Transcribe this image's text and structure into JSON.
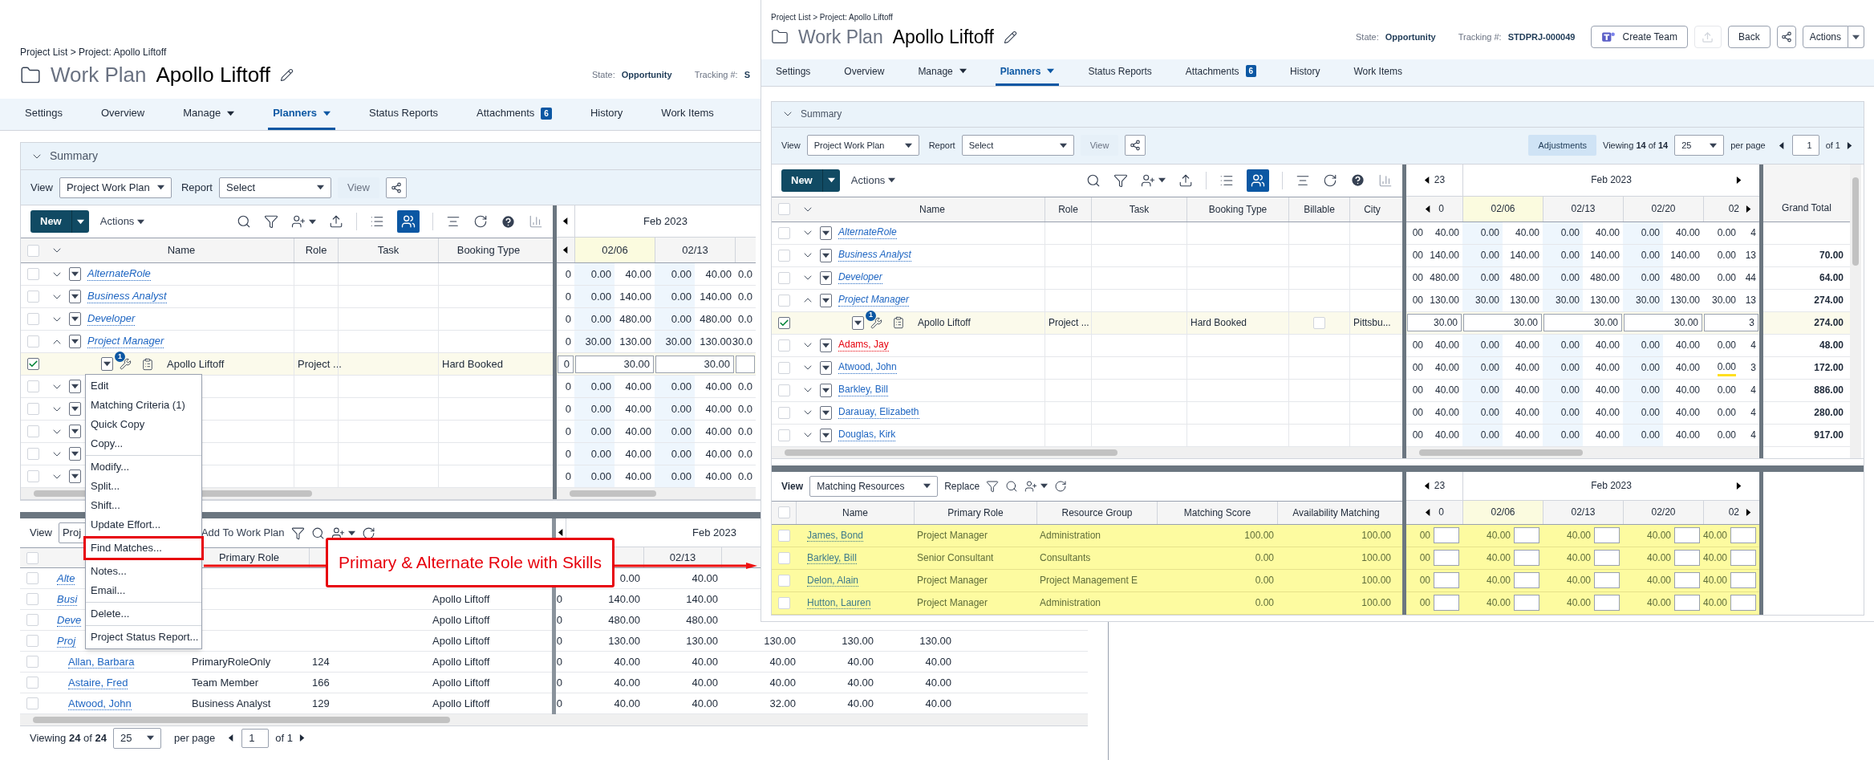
{
  "left": {
    "breadcrumb": "Project List > Project: Apollo Liftoff",
    "title_prefix": "Work Plan",
    "title": "Apollo Liftoff",
    "state_label": "State:",
    "state": "Opportunity",
    "tracking_label": "Tracking #:",
    "tracking": "S",
    "tabs": [
      {
        "label": "Settings",
        "selected": false,
        "dropdown": false
      },
      {
        "label": "Overview",
        "selected": false,
        "dropdown": false
      },
      {
        "label": "Manage",
        "selected": false,
        "dropdown": true
      },
      {
        "label": "Planners",
        "selected": true,
        "dropdown": true
      },
      {
        "label": "Status Reports",
        "selected": false,
        "dropdown": false
      },
      {
        "label": "Attachments",
        "selected": false,
        "dropdown": false,
        "badge": "6"
      },
      {
        "label": "History",
        "selected": false,
        "dropdown": false
      },
      {
        "label": "Work Items",
        "selected": false,
        "dropdown": false
      }
    ],
    "summary": {
      "label": "Summary",
      "expanded": true
    },
    "view_bar": {
      "view_label": "View",
      "view": "Project Work Plan",
      "report_label": "Report",
      "report": "Select",
      "view_button": "View"
    },
    "grid": {
      "new": "New",
      "actions": "Actions",
      "all_checked": false,
      "columns": [
        "Name",
        "Role",
        "Task",
        "Booking Type"
      ],
      "timeline": {
        "month": "Feb 2023",
        "dates": [
          {
            "label": "02/06",
            "selected": true
          },
          {
            "label": "02/13",
            "selected": false
          }
        ]
      },
      "rows": [
        {
          "kind": "group",
          "name": "AlternateRole",
          "checked": false,
          "expanded": false,
          "cells": [
            [
              "0"
            ],
            [
              "0.00",
              "40.00"
            ],
            [
              "0.00",
              "40.00"
            ],
            [
              "0.0"
            ]
          ]
        },
        {
          "kind": "group",
          "name": "Business Analyst",
          "checked": false,
          "expanded": false,
          "cells": [
            [
              "0"
            ],
            [
              "0.00",
              "140.00"
            ],
            [
              "0.00",
              "140.00"
            ],
            [
              "0.0"
            ]
          ]
        },
        {
          "kind": "group",
          "name": "Developer",
          "checked": false,
          "expanded": false,
          "cells": [
            [
              "0"
            ],
            [
              "0.00",
              "480.00"
            ],
            [
              "0.00",
              "480.00"
            ],
            [
              "0.0"
            ]
          ]
        },
        {
          "kind": "group",
          "name": "Project Manager",
          "checked": false,
          "expanded": true,
          "cells": [
            [
              "0"
            ],
            [
              "30.00",
              "130.00"
            ],
            [
              "30.00",
              "130.00"
            ],
            [
              "30.0"
            ]
          ]
        },
        {
          "kind": "task",
          "name": "Apollo Liftoff",
          "badge": "1",
          "role": "Project ...",
          "booking": "Hard Booked",
          "checked": true,
          "cells": [
            "0",
            "30.00",
            "30.00"
          ]
        },
        {
          "kind": "resource",
          "checked": false,
          "expanded": false,
          "cells": [
            [
              "0"
            ],
            [
              "0.00",
              "40.00"
            ],
            [
              "0.00",
              "40.00"
            ],
            [
              "0.0"
            ]
          ]
        },
        {
          "kind": "resource",
          "checked": false,
          "expanded": false,
          "cells": [
            [
              "0"
            ],
            [
              "0.00",
              "40.00"
            ],
            [
              "0.00",
              "40.00"
            ],
            [
              "0.0"
            ]
          ]
        },
        {
          "kind": "resource",
          "checked": false,
          "expanded": false,
          "cells": [
            [
              "0"
            ],
            [
              "0.00",
              "40.00"
            ],
            [
              "0.00",
              "40.00"
            ],
            [
              "0.0"
            ]
          ]
        },
        {
          "kind": "resource",
          "checked": false,
          "expanded": false,
          "cells": [
            [
              "0"
            ],
            [
              "0.00",
              "40.00"
            ],
            [
              "0.00",
              "40.00"
            ],
            [
              "0.0"
            ]
          ]
        },
        {
          "kind": "resource",
          "checked": false,
          "expanded": false,
          "cells": [
            [
              "0"
            ],
            [
              "0.00",
              "40.00"
            ],
            [
              "0.00",
              "40.00"
            ],
            [
              "0.0"
            ]
          ]
        }
      ]
    },
    "menu": [
      {
        "label": "Edit",
        "divider_above": false,
        "highlighted": false
      },
      {
        "label": "Matching Criteria (1)",
        "divider_above": false,
        "highlighted": false
      },
      {
        "label": "Quick Copy",
        "divider_above": false,
        "highlighted": false
      },
      {
        "label": "Copy...",
        "divider_above": false,
        "highlighted": false
      },
      {
        "label": "Modify...",
        "divider_above": true,
        "highlighted": false
      },
      {
        "label": "Split...",
        "divider_above": false,
        "highlighted": false
      },
      {
        "label": "Shift...",
        "divider_above": false,
        "highlighted": false
      },
      {
        "label": "Update Effort...",
        "divider_above": false,
        "highlighted": false
      },
      {
        "label": "Find Matches...",
        "divider_above": true,
        "highlighted": true
      },
      {
        "label": "Notes...",
        "divider_above": true,
        "highlighted": false
      },
      {
        "label": "Email...",
        "divider_above": false,
        "highlighted": false
      },
      {
        "label": "Delete...",
        "divider_above": true,
        "highlighted": false
      },
      {
        "label": "Project Status Report...",
        "divider_above": true,
        "highlighted": false
      }
    ],
    "lower": {
      "view_label": "View",
      "view": "Proj",
      "add": "Add To Work Plan",
      "all_checked": false,
      "role_header": "Primary Role",
      "timeline": {
        "month": "Feb 2023",
        "dates": [
          {
            "label": "02/13",
            "selected": false
          }
        ]
      },
      "rows": [
        {
          "name": "Alte",
          "kind": "group",
          "checked": false,
          "cells": [
            "",
            "0.00",
            "40.00"
          ]
        },
        {
          "name": "Busi",
          "kind": "group",
          "checked": false,
          "project": "Apollo Liftoff",
          "cells": [
            "0",
            "140.00",
            "140.00"
          ]
        },
        {
          "name": "Deve",
          "kind": "group",
          "checked": false,
          "project": "Apollo Liftoff",
          "cells": [
            "0",
            "480.00",
            "480.00"
          ]
        },
        {
          "name": "Proj",
          "kind": "group",
          "checked": false,
          "project": "Apollo Liftoff",
          "cells": [
            "0",
            "130.00",
            "130.00",
            "130.00",
            "130.00",
            "130.00"
          ]
        },
        {
          "name": "Allan, Barbara",
          "kind": "resource",
          "checked": false,
          "role": "PrimaryRoleOnly",
          "number": "124",
          "project": "Apollo Liftoff",
          "cells": [
            "0",
            "40.00",
            "40.00",
            "40.00",
            "40.00",
            "40.00"
          ]
        },
        {
          "name": "Astaire, Fred",
          "kind": "resource",
          "checked": false,
          "role": "Team Member",
          "number": "166",
          "project": "Apollo Liftoff",
          "cells": [
            "0",
            "40.00",
            "40.00",
            "40.00",
            "40.00",
            "40.00"
          ]
        },
        {
          "name": "Atwood, John",
          "kind": "resource",
          "checked": false,
          "role": "Business Analyst",
          "number": "129",
          "project": "Apollo Liftoff",
          "cells": [
            "0",
            "40.00",
            "40.00",
            "32.00",
            "40.00",
            "40.00"
          ]
        }
      ],
      "footer": {
        "viewing": "Viewing **24** of **24**",
        "per_page_value": "25",
        "per_page": "per page",
        "page": "1",
        "of": "of 1"
      }
    }
  },
  "right": {
    "breadcrumb": "Project List > Project: Apollo Liftoff",
    "title_prefix": "Work Plan",
    "title": "Apollo Liftoff",
    "state_label": "State:",
    "state": "Opportunity",
    "tracking_label": "Tracking #:",
    "tracking": "STDPRJ-000049",
    "create_team": "Create Team",
    "back": "Back",
    "actions": "Actions",
    "tabs": [
      {
        "label": "Settings",
        "selected": false,
        "dropdown": false
      },
      {
        "label": "Overview",
        "selected": false,
        "dropdown": false
      },
      {
        "label": "Manage",
        "selected": false,
        "dropdown": true
      },
      {
        "label": "Planners",
        "selected": true,
        "dropdown": true
      },
      {
        "label": "Status Reports",
        "selected": false,
        "dropdown": false
      },
      {
        "label": "Attachments",
        "selected": false,
        "dropdown": false,
        "badge": "6"
      },
      {
        "label": "History",
        "selected": false,
        "dropdown": false
      },
      {
        "label": "Work Items",
        "selected": false,
        "dropdown": false
      }
    ],
    "summary": {
      "label": "Summary",
      "expanded": true
    },
    "view_bar": {
      "view_label": "View",
      "view": "Project Work Plan",
      "report_label": "Report",
      "report": "Select",
      "view_button": "View",
      "adjustments": "Adjustments",
      "viewing": "Viewing **14** of **14**",
      "per_page_value": "25",
      "per_page": "per page",
      "page": "1",
      "of": "of 1"
    },
    "grid": {
      "new": "New",
      "actions": "Actions",
      "all_checked": false,
      "columns": [
        "Name",
        "Role",
        "Task",
        "Booking Type",
        "Billable",
        "City"
      ],
      "total_header": "Grand Total",
      "timeline": {
        "month": "Feb 2023",
        "month_prev": "23",
        "lead_label": "0",
        "tail_label": "02",
        "dates": [
          {
            "label": "02/06",
            "selected": true
          },
          {
            "label": "02/13",
            "selected": false
          },
          {
            "label": "02/20",
            "selected": false
          }
        ]
      },
      "rows": [
        {
          "kind": "group",
          "name": "AlternateRole",
          "checked": false,
          "expanded": false,
          "highlighted": false,
          "cells": [
            [
              "00",
              "40.00"
            ],
            [
              "0.00",
              "40.00"
            ],
            [
              "0.00",
              "40.00"
            ],
            [
              "0.00",
              "40.00"
            ],
            [
              "0.00",
              "4"
            ]
          ]
        },
        {
          "kind": "group",
          "name": "Business Analyst",
          "checked": false,
          "expanded": false,
          "highlighted": false,
          "total": "70.00",
          "cells": [
            [
              "00",
              "140.00"
            ],
            [
              "0.00",
              "140.00"
            ],
            [
              "0.00",
              "140.00"
            ],
            [
              "0.00",
              "140.00"
            ],
            [
              "0.00",
              "13"
            ]
          ]
        },
        {
          "kind": "group",
          "name": "Developer",
          "checked": false,
          "expanded": false,
          "highlighted": false,
          "total": "64.00",
          "cells": [
            [
              "00",
              "480.00"
            ],
            [
              "0.00",
              "480.00"
            ],
            [
              "0.00",
              "480.00"
            ],
            [
              "0.00",
              "480.00"
            ],
            [
              "0.00",
              "44"
            ]
          ]
        },
        {
          "kind": "group",
          "name": "Project Manager",
          "checked": false,
          "expanded": true,
          "highlighted": false,
          "total": "274.00",
          "cells": [
            [
              "00",
              "130.00"
            ],
            [
              "30.00",
              "130.00"
            ],
            [
              "30.00",
              "130.00"
            ],
            [
              "30.00",
              "130.00"
            ],
            [
              "30.00",
              "13"
            ]
          ]
        },
        {
          "kind": "task",
          "name": "Apollo Liftoff",
          "badge": "1",
          "role": "Project ...",
          "booking": "Hard Booked",
          "billable": false,
          "city": "Pittsbu...",
          "checked": true,
          "highlighted": false,
          "total": "274.00",
          "cells": [
            "30.00",
            "30.00",
            "30.00",
            "30.00",
            "3"
          ]
        },
        {
          "kind": "resource",
          "name": "Adams, Jay",
          "overallocated": true,
          "checked": false,
          "expanded": false,
          "highlighted": false,
          "total": "48.00",
          "cells": [
            [
              "00",
              "40.00"
            ],
            [
              "0.00",
              "40.00"
            ],
            [
              "0.00",
              "40.00"
            ],
            [
              "0.00",
              "40.00"
            ],
            [
              "0.00",
              "4"
            ]
          ]
        },
        {
          "kind": "resource",
          "name": "Atwood, John",
          "overallocated": false,
          "checked": false,
          "expanded": false,
          "highlighted": true,
          "total": "172.00",
          "cells": [
            [
              "00",
              "40.00"
            ],
            [
              "0.00",
              "40.00"
            ],
            [
              "0.00",
              "40.00"
            ],
            [
              "0.00",
              "40.00"
            ],
            [
              "0.00",
              "3"
            ]
          ]
        },
        {
          "kind": "resource",
          "name": "Barkley, Bill",
          "overallocated": false,
          "checked": false,
          "expanded": false,
          "highlighted": false,
          "total": "886.00",
          "cells": [
            [
              "00",
              "40.00"
            ],
            [
              "0.00",
              "40.00"
            ],
            [
              "0.00",
              "40.00"
            ],
            [
              "0.00",
              "40.00"
            ],
            [
              "0.00",
              "4"
            ]
          ]
        },
        {
          "kind": "resource",
          "name": "Darauay, Elizabeth",
          "overallocated": false,
          "checked": false,
          "expanded": false,
          "highlighted": false,
          "total": "280.00",
          "cells": [
            [
              "00",
              "40.00"
            ],
            [
              "0.00",
              "40.00"
            ],
            [
              "0.00",
              "40.00"
            ],
            [
              "0.00",
              "40.00"
            ],
            [
              "0.00",
              "4"
            ]
          ]
        },
        {
          "kind": "resource",
          "name": "Douglas, Kirk",
          "overallocated": false,
          "checked": false,
          "expanded": false,
          "highlighted": false,
          "total": "917.00",
          "cells": [
            [
              "00",
              "40.00"
            ],
            [
              "0.00",
              "40.00"
            ],
            [
              "0.00",
              "40.00"
            ],
            [
              "0.00",
              "40.00"
            ],
            [
              "0.00",
              "4"
            ]
          ]
        }
      ]
    },
    "lower": {
      "view_label": "View",
      "view": "Matching Resources",
      "replace": "Replace",
      "all_checked": false,
      "columns": [
        "Name",
        "Primary Role",
        "Resource Group",
        "Matching Score",
        "Availability Matching"
      ],
      "timeline": {
        "month": "Feb 2023",
        "month_prev": "23",
        "lead_label": "0",
        "tail_label": "02",
        "dates": [
          {
            "label": "02/06",
            "selected": true
          },
          {
            "label": "02/13",
            "selected": false
          },
          {
            "label": "02/20",
            "selected": false
          }
        ]
      },
      "rows": [
        {
          "name": "James, Bond",
          "role": "Project Manager",
          "group": "Administration",
          "score": "100.00",
          "availability": "100.00",
          "checked": false,
          "cells": [
            "00",
            "40.00",
            "40.00",
            "40.00",
            "40.00"
          ]
        },
        {
          "name": "Barkley, Bill",
          "role": "Senior Consultant",
          "group": "Consultants",
          "score": "0.00",
          "availability": "100.00",
          "checked": false,
          "cells": [
            "00",
            "40.00",
            "40.00",
            "40.00",
            "40.00"
          ]
        },
        {
          "name": "Delon, Alain",
          "role": "Project Manager",
          "group": "Project Management E",
          "score": "0.00",
          "availability": "100.00",
          "checked": false,
          "cells": [
            "00",
            "40.00",
            "40.00",
            "40.00",
            "40.00"
          ]
        },
        {
          "name": "Hutton, Lauren",
          "role": "Project Manager",
          "group": "Administration",
          "score": "0.00",
          "availability": "100.00",
          "checked": false,
          "cells": [
            "00",
            "40.00",
            "40.00",
            "40.00",
            "40.00"
          ]
        }
      ]
    }
  },
  "callout": "Primary & Alternate Role with Skills"
}
